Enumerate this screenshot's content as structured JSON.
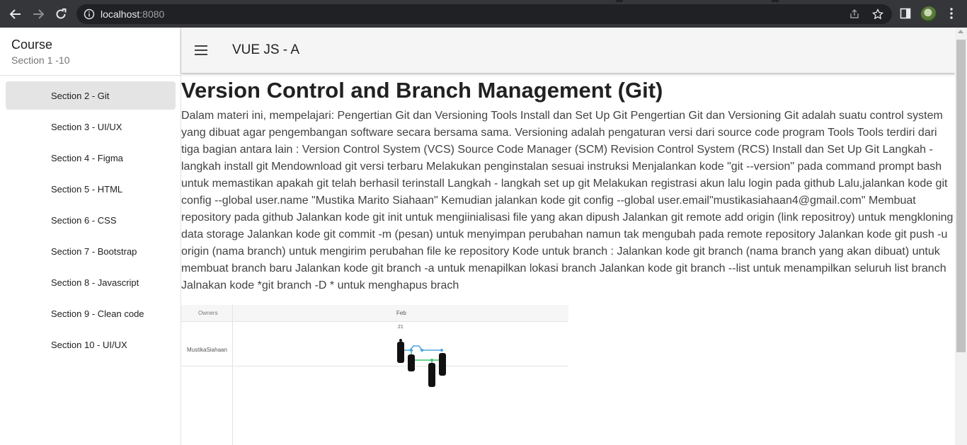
{
  "browser": {
    "url_host": "localhost",
    "url_port": ":8080",
    "icons": [
      "back-icon",
      "forward-icon",
      "reload-icon",
      "info-icon",
      "share-icon",
      "star-icon",
      "side-panel-icon",
      "profile-avatar",
      "kebab-menu-icon"
    ]
  },
  "sidebar": {
    "title": "Course",
    "subtitle": "Section 1 -10",
    "items": [
      {
        "label": "Section 2 - Git",
        "active": true
      },
      {
        "label": "Section 3 - UI/UX",
        "active": false
      },
      {
        "label": "Section 4 - Figma",
        "active": false
      },
      {
        "label": "Section 5 - HTML",
        "active": false
      },
      {
        "label": "Section 6 - CSS",
        "active": false
      },
      {
        "label": "Section 7 - Bootstrap",
        "active": false
      },
      {
        "label": "Section 8 - Javascript",
        "active": false
      },
      {
        "label": "Section 9 - Clean code",
        "active": false
      },
      {
        "label": "Section 10 - UI/UX",
        "active": false
      }
    ]
  },
  "appbar": {
    "title": "VUE JS - A",
    "menu_icon": "hamburger-menu-icon"
  },
  "content": {
    "heading": "Version Control and Branch Management (Git)",
    "body": "Dalam materi ini, mempelajari: Pengertian Git dan Versioning Tools Install dan Set Up Git Pengertian Git dan Versioning Git adalah suatu control system yang dibuat agar pengembangan software secara bersama sama. Versioning adalah pengaturan versi dari source code program Tools Tools terdiri dari tiga bagian antara lain : Version Control System (VCS) Source Code Manager (SCM) Revision Control System (RCS) Install dan Set Up Git Langkah - langkah install git Mendownload git versi terbaru Melakukan penginstalan sesuai instruksi Menjalankan kode \"git --version\" pada command prompt bash untuk memastikan apakah git telah berhasil terinstall Langkah - langkah set up git Melakukan registrasi akun lalu login pada github Lalu,jalankan kode git config --global user.name \"Mustika Marito Siahaan\" Kemudian jalankan kode git config --global user.email\"mustikasiahaan4@gmail.com\" Membuat repository pada github Jalankan kode git init untuk mengiinialisasi file yang akan dipush Jalankan git remote add origin (link repositroy) untuk mengkloning data storage Jalankan kode git commit -m (pesan) untuk menyimpan perubahan namun tak mengubah pada remote repository Jalankan kode git push -u origin (nama branch) untuk mengirim perubahan file ke repository Kode untuk branch : Jalankan kode git branch (nama branch yang akan dibuat) untuk membuat branch baru Jalankan kode git branch -a untuk menapilkan lokasi branch Jalankan kode git branch --list untuk menampilkan seluruh list branch Jalnakan kode *git branch -D * untuk menghapus brach"
  },
  "figure": {
    "col_owners": "Owners",
    "col_month": "Feb",
    "day": "21",
    "owner": "MustikaSiahaan",
    "colors": {
      "blue": "#4aa3df",
      "green": "#3fbf6f",
      "tag": "#111111"
    }
  }
}
